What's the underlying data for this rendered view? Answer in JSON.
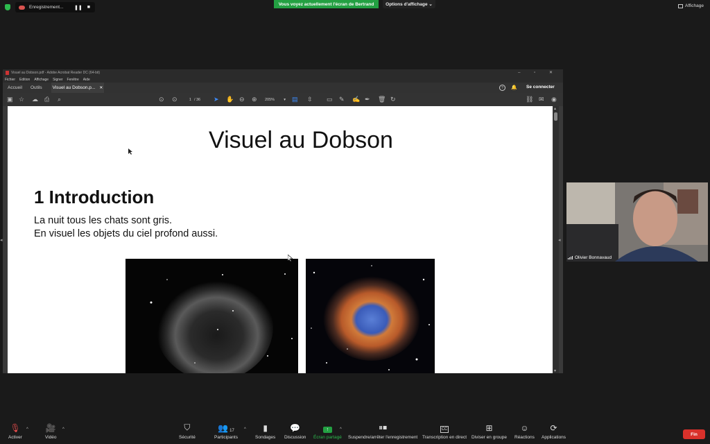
{
  "zoom_top": {
    "recording_label": "Enregistrement...",
    "share_banner": "Vous voyez actuellement l'écran de Bertrand",
    "view_options": "Options d'affichage",
    "view_caret": "⌄",
    "affichage": "Affichage"
  },
  "acrobat": {
    "window_title": "Visuel au Dobson.pdf - Adobe Acrobat Reader DC (64-bit)",
    "window_controls": "– ▫ ✕",
    "menu": [
      "Fichier",
      "Edition",
      "Affichage",
      "Signer",
      "Fenêtre",
      "Aide"
    ],
    "tabs": {
      "home": "Accueil",
      "tools": "Outils",
      "document": "Visuel au Dobson.p...",
      "close": "✕"
    },
    "help": "?",
    "connect": "Se connecter",
    "page_current": "1",
    "page_total": "/ 36",
    "zoom": "205%"
  },
  "slide": {
    "title": "Visuel au Dobson",
    "heading": "1 Introduction",
    "line1": "La nuit tous les chats sont gris.",
    "line2": "En visuel les objets du ciel profond aussi."
  },
  "video": {
    "participant_name": "Olivier Bonnavaud"
  },
  "bottom_bar": {
    "mute": "Activer",
    "video": "Vidéo",
    "security": "Sécurité",
    "participants": "Participants",
    "participants_count": "17",
    "polls": "Sondages",
    "chat": "Discussion",
    "share": "Écran partagé",
    "record": "Suspendre/arrêter l'enregistrement",
    "transcription": "Transcription en direct",
    "breakout": "Diviser en groupe",
    "reactions": "Réactions",
    "apps": "Applications",
    "end": "Fin"
  },
  "colors": {
    "share_green": "#23a042",
    "end_red": "#d9312b",
    "recording_red": "#d9534f"
  }
}
